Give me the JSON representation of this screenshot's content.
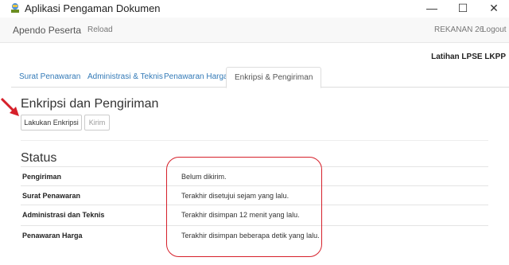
{
  "window": {
    "title": "Aplikasi Pengaman Dokumen",
    "minimize": "—",
    "maximize": "☐",
    "close": "✕"
  },
  "navbar": {
    "brand": "Apendo Peserta",
    "reload": "Reload",
    "user": "REKANAN 26",
    "logout": "Logout"
  },
  "organization": "Latihan LPSE LKPP",
  "tabs": [
    {
      "label": "Surat Penawaran"
    },
    {
      "label": "Administrasi & Teknis"
    },
    {
      "label": "Penawaran Harga"
    },
    {
      "label": "Enkripsi & Pengiriman"
    }
  ],
  "active_tab": "Enkripsi & Pengiriman",
  "section": {
    "title": "Enkripsi dan Pengiriman",
    "encrypt_button": "Lakukan Enkripsi",
    "send_button": "Kirim"
  },
  "status": {
    "title": "Status",
    "rows": [
      {
        "label": "Pengiriman",
        "value": "Belum dikirim."
      },
      {
        "label": "Surat Penawaran",
        "value": "Terakhir disetujui sejam yang lalu."
      },
      {
        "label": "Administrasi dan Teknis",
        "value": "Terakhir disimpan 12 menit yang lalu."
      },
      {
        "label": "Penawaran Harga",
        "value": "Terakhir disimpan beberapa detik yang lalu."
      }
    ]
  },
  "colors": {
    "link": "#337ab7",
    "annotation": "#d6202a",
    "navbar_bg": "#f8f8f8"
  },
  "icons": {
    "app": "app-icon",
    "annotation_arrow": "arrow-icon"
  }
}
